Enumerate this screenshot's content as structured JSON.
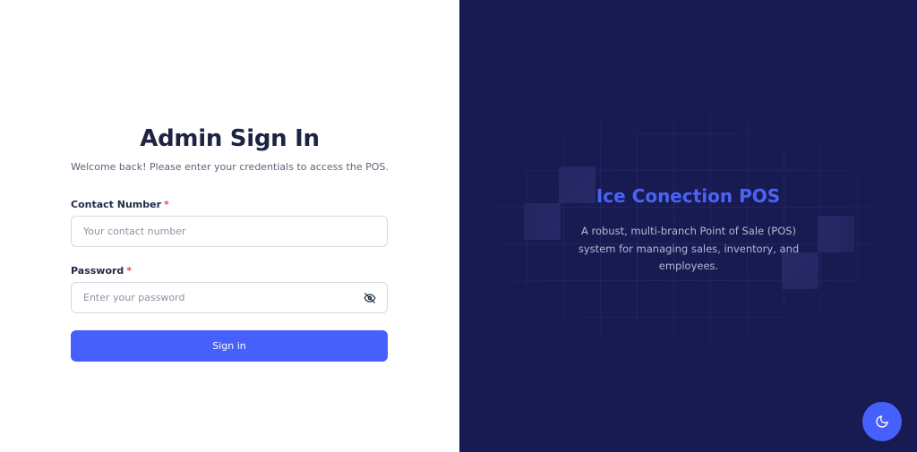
{
  "signin": {
    "title": "Admin Sign In",
    "subtitle": "Welcome back! Please enter your credentials to access the POS.",
    "contact_label": "Contact Number",
    "contact_placeholder": "Your contact number",
    "contact_value": "",
    "password_label": "Password",
    "password_placeholder": "Enter your password",
    "password_value": "",
    "required_mark": "*",
    "submit_label": "Sign in",
    "password_toggle_icon": "eye-off-icon"
  },
  "hero": {
    "brand": "Ice Conection POS",
    "tagline": "A robust, multi-branch Point of Sale (POS) system for managing sales, inventory, and employees."
  },
  "theme_toggle": {
    "icon": "moon-icon"
  },
  "colors": {
    "accent": "#4660fc",
    "panel_bg": "#181b52",
    "brand_text": "#4a63f5",
    "title_text": "#1d2340",
    "required": "#ef4444"
  }
}
